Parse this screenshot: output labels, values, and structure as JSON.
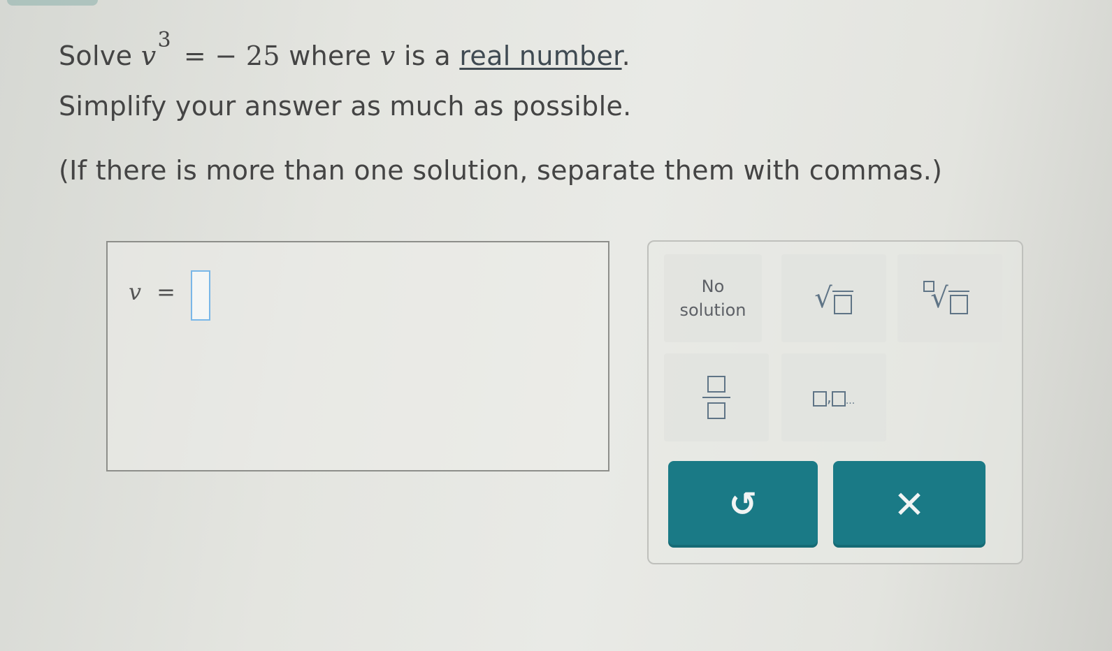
{
  "question": {
    "solve_word": "Solve",
    "equation_var": "v",
    "equation_exponent": "3",
    "equation_rhs": "= − 25",
    "where_text": "where",
    "where_var": "v",
    "is_a_text": "is a",
    "link_text": "real number",
    "period": ".",
    "instruction": "Simplify your answer as much as possible.",
    "note": "(If there is more than one solution, separate them with commas.)"
  },
  "answer": {
    "var": "v",
    "equals": "=",
    "value": ""
  },
  "keypad": {
    "no_solution_line1": "No",
    "no_solution_line2": "solution",
    "sqrt_symbol": "√",
    "nthroot_symbol": "√",
    "list_separator": ",",
    "list_ellipsis": "...",
    "undo_symbol": "↺",
    "clear_symbol": "✕"
  },
  "colors": {
    "action_button": "#1a7a86",
    "input_slot_border": "#79b7e8"
  }
}
